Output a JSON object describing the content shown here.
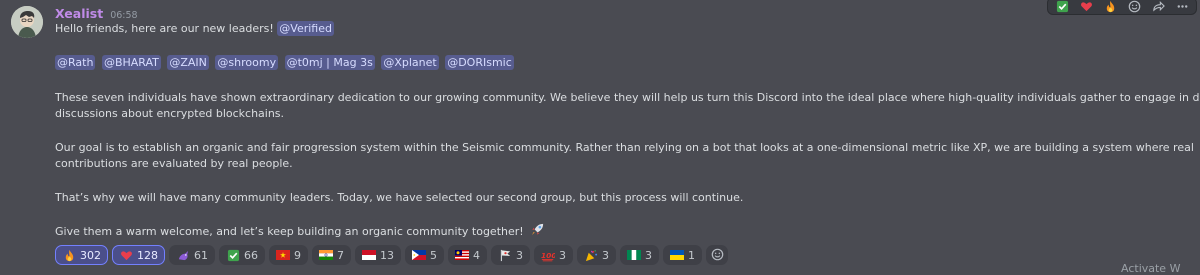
{
  "message": {
    "username": "Xealist",
    "timestamp": "06:58",
    "greeting": "Hello friends, here are our new leaders!",
    "greeting_mention": "@Verified",
    "leaders": [
      "@Rath",
      "@BHARAT",
      "@ZAIN",
      "@shroomy",
      "@t0mj | Mag 3s",
      "@Xplanet",
      "@DORIsmic"
    ],
    "paragraph1_line1": "These seven individuals have shown extraordinary dedication to our growing community. We believe they will help us turn this Discord into the ideal place where high-quality individuals gather to engage in deep",
    "paragraph1_line2": "discussions about encrypted blockchains.",
    "paragraph2_line1": "Our goal is to establish an organic and fair progression system within the Seismic community. Rather than relying on a bot that looks at a one-dimensional metric like XP, we are building a system where real",
    "paragraph2_line2": "contributions are evaluated by real people.",
    "paragraph3": "That’s why we will have many community leaders. Today, we have selected our second group, but this process will continue.",
    "paragraph4": "Give them a warm welcome, and let’s keep building an organic community together!"
  },
  "reactions": [
    {
      "icon": "fire-emoji",
      "glyph": "🔥",
      "count": "302",
      "active": true
    },
    {
      "icon": "heart-emoji",
      "glyph": "♥",
      "count": "128",
      "active": true
    },
    {
      "icon": "purple-dragon-emoji",
      "glyph": "🐉",
      "count": "61",
      "active": false
    },
    {
      "icon": "check-mark-emoji",
      "glyph": "✔",
      "count": "66",
      "active": false
    },
    {
      "icon": "vietnam-flag-emoji",
      "glyph": "★",
      "count": "9",
      "active": false
    },
    {
      "icon": "india-flag-emoji",
      "glyph": "",
      "count": "7",
      "active": false
    },
    {
      "icon": "indonesia-flag-emoji",
      "glyph": "",
      "count": "13",
      "active": false
    },
    {
      "icon": "philippines-flag-emoji",
      "glyph": "",
      "count": "5",
      "active": false
    },
    {
      "icon": "malaysia-flag-emoji",
      "glyph": "",
      "count": "4",
      "active": false
    },
    {
      "icon": "custom-flag-emoji",
      "glyph": "⚑",
      "count": "3",
      "active": false
    },
    {
      "icon": "hundred-points-emoji",
      "glyph": "100",
      "count": "3",
      "active": false
    },
    {
      "icon": "party-popper-emoji",
      "glyph": "🎉",
      "count": "3",
      "active": false
    },
    {
      "icon": "nigeria-flag-emoji",
      "glyph": "",
      "count": "3",
      "active": false
    },
    {
      "icon": "ukraine-flag-emoji",
      "glyph": "",
      "count": "1",
      "active": false
    }
  ],
  "watermark": "Activate W",
  "colors": {
    "background": "#4a4b52",
    "username": "#c08be8",
    "mention_bg": "#575c8f",
    "reaction_active_border": "#7380ff"
  }
}
